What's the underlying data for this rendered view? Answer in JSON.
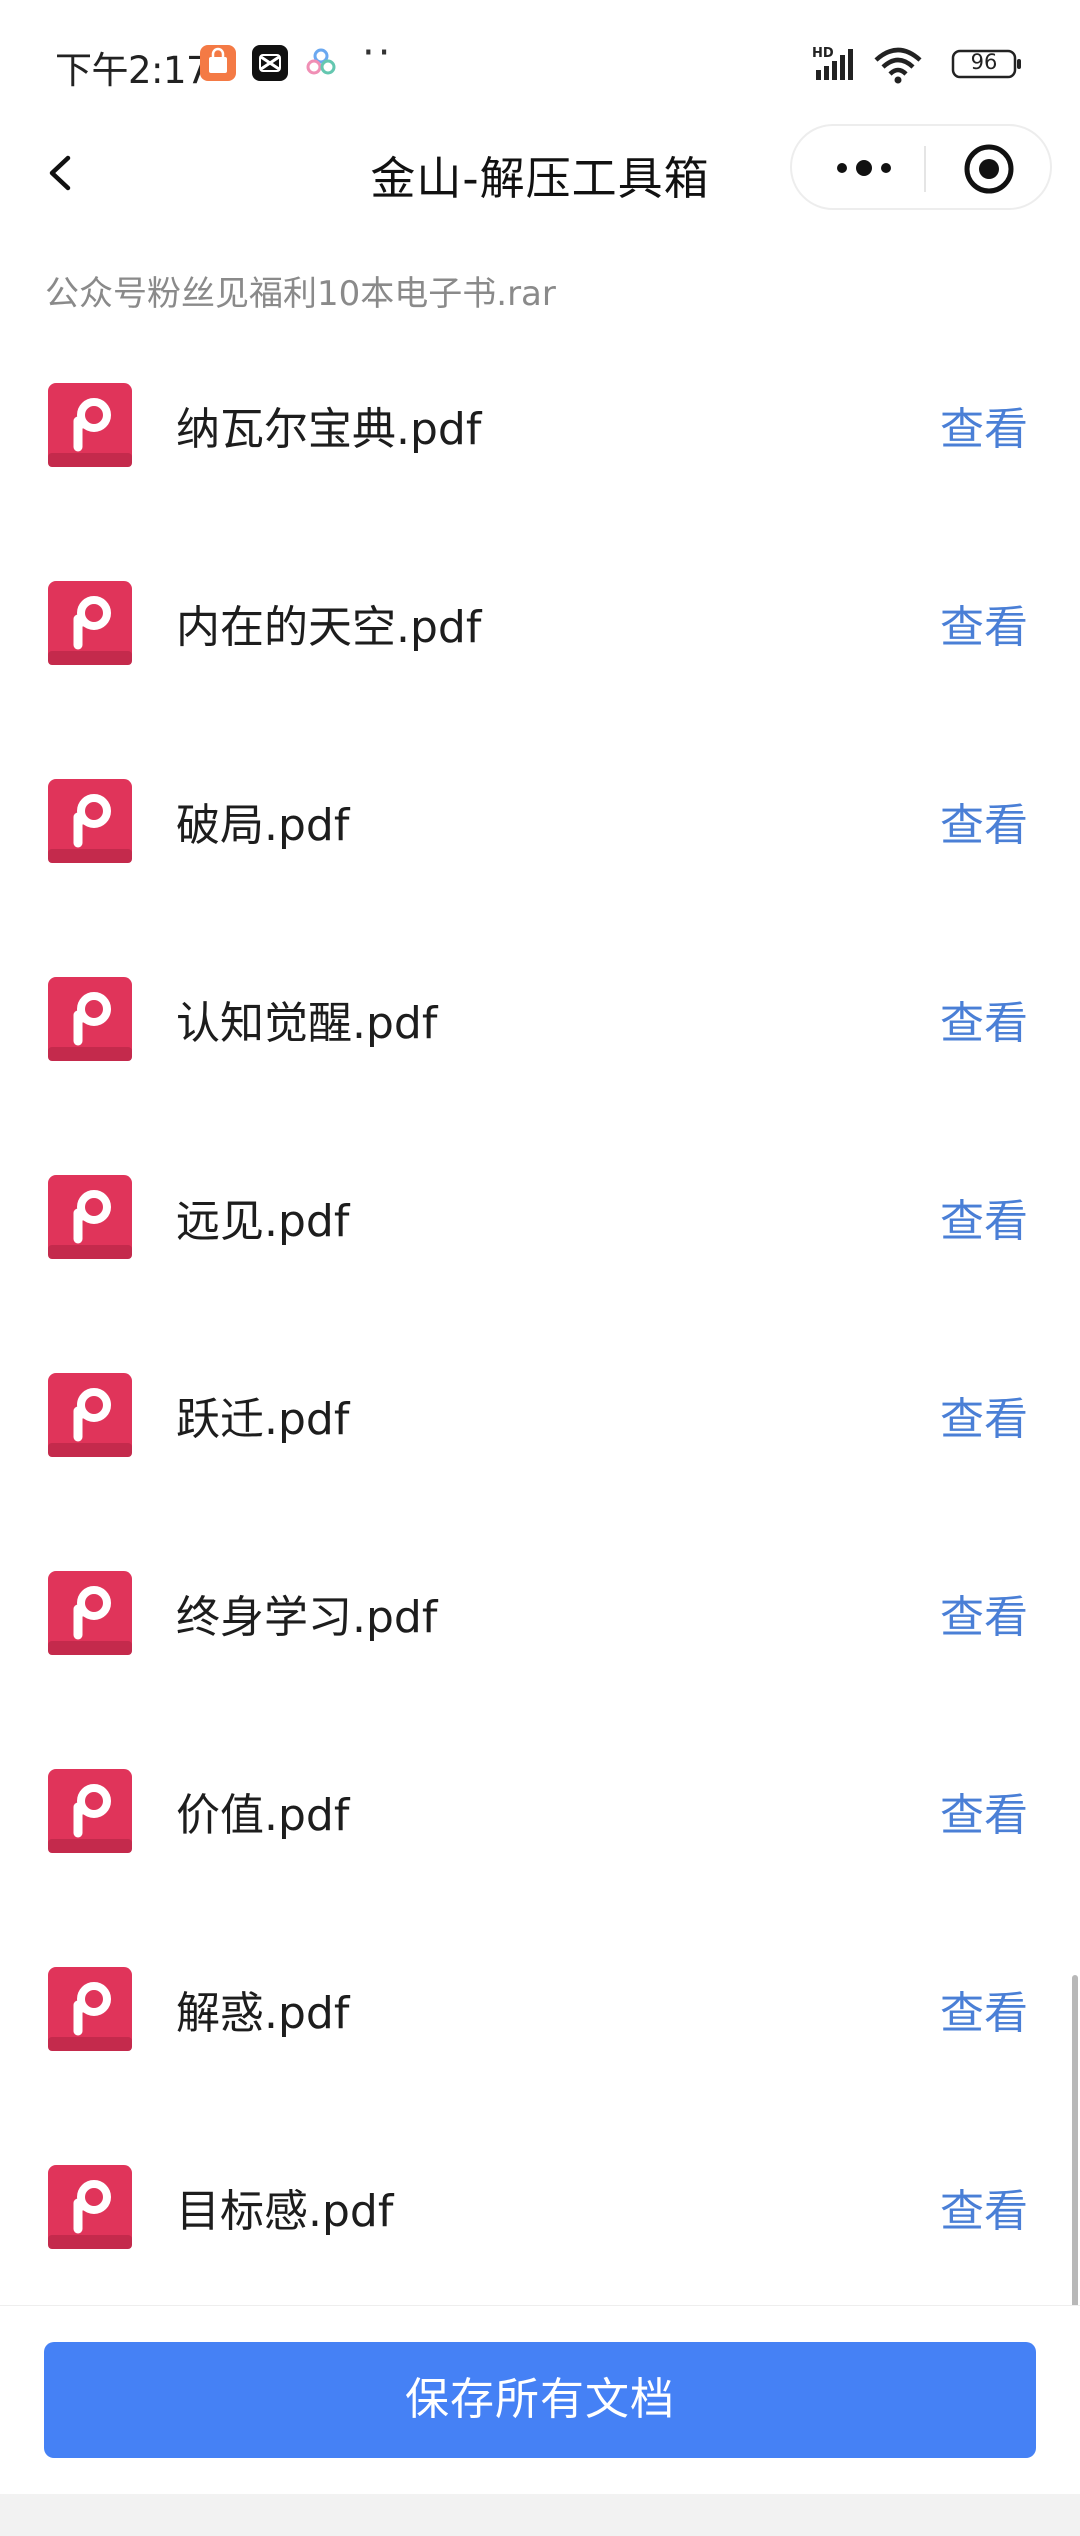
{
  "status_bar": {
    "time": "下午2:17",
    "battery": "96"
  },
  "nav": {
    "title": "金山-解压工具箱"
  },
  "archive_name": "公众号粉丝见福利10本电子书.rar",
  "files": [
    {
      "name": "纳瓦尔宝典.pdf",
      "action": "查看"
    },
    {
      "name": "内在的天空.pdf",
      "action": "查看"
    },
    {
      "name": "破局.pdf",
      "action": "查看"
    },
    {
      "name": "认知觉醒.pdf",
      "action": "查看"
    },
    {
      "name": "远见.pdf",
      "action": "查看"
    },
    {
      "name": "跃迁.pdf",
      "action": "查看"
    },
    {
      "name": "终身学习.pdf",
      "action": "查看"
    },
    {
      "name": "价值.pdf",
      "action": "查看"
    },
    {
      "name": "解惑.pdf",
      "action": "查看"
    },
    {
      "name": "目标感.pdf",
      "action": "查看"
    }
  ],
  "save_all_label": "保存所有文档",
  "colors": {
    "accent": "#4581f5",
    "link": "#4a7fd6",
    "pdf_icon": "#e0345a"
  }
}
